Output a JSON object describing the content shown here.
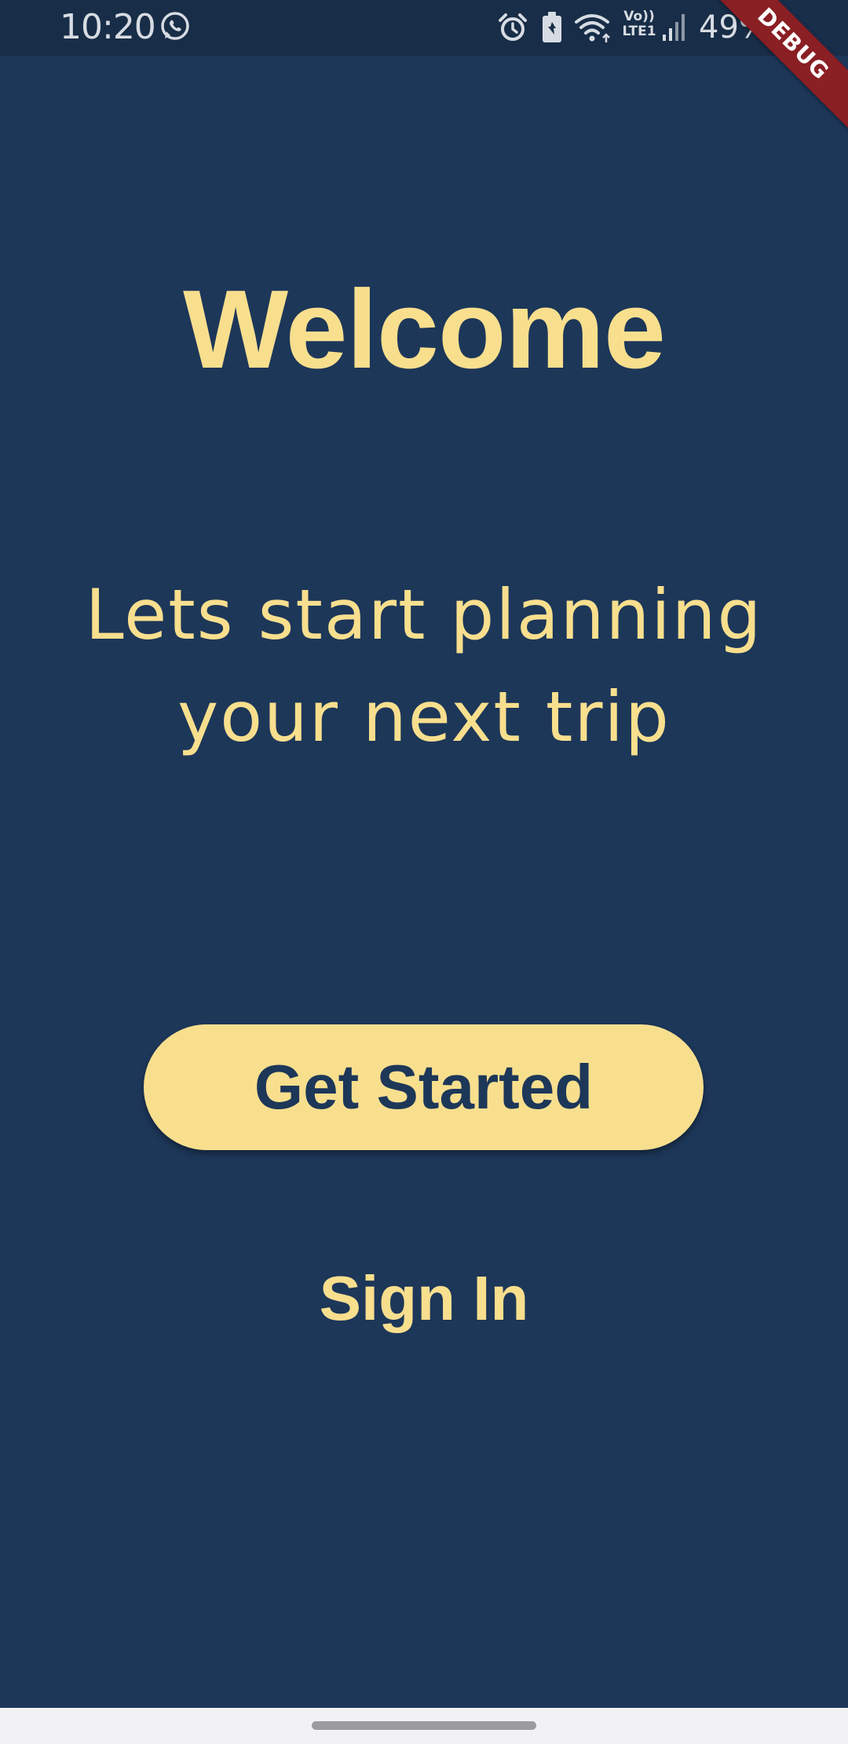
{
  "status_bar": {
    "time": "10:20",
    "volte_label": "Vo))\nLTE1",
    "battery_percent": "49%",
    "icons": [
      "whatsapp-icon",
      "alarm-icon",
      "battery-saver-icon",
      "wifi-icon",
      "volte-icon",
      "signal-icon",
      "battery-icon"
    ]
  },
  "debug_banner": "DEBUG",
  "main": {
    "title": "Welcome",
    "subtitle_line1": "Lets start planning",
    "subtitle_line2": "your next trip",
    "get_started_label": "Get Started",
    "sign_in_label": "Sign In"
  },
  "colors": {
    "background": "#1d3759",
    "accent": "#f8df8e",
    "status_bar": "#182d47",
    "debug_banner": "#8a1f24"
  }
}
